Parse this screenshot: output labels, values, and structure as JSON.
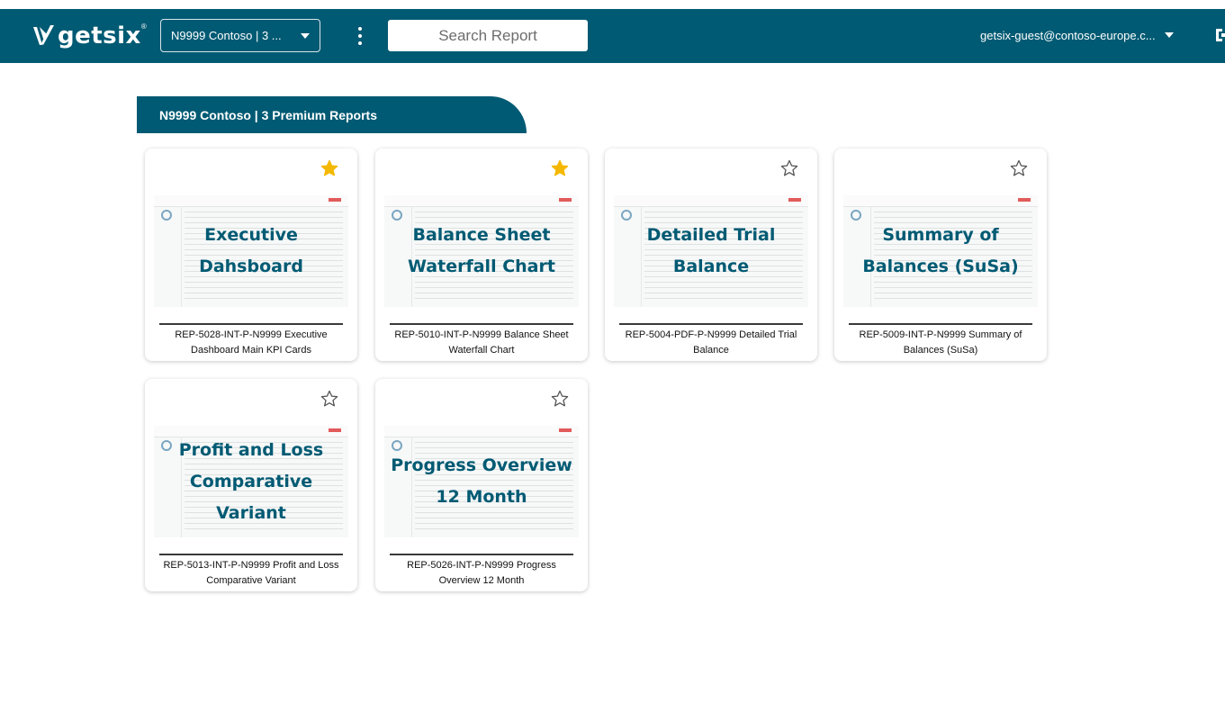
{
  "header": {
    "logo_text": "getsix",
    "logo_reg": "®",
    "client_selector": "N9999 Contoso | 3 ...",
    "search_placeholder": "Search Report",
    "user": "getsix-guest@contoso-europe.c..."
  },
  "section": {
    "title": "N9999 Contoso | 3 Premium Reports"
  },
  "reports": [
    {
      "thumb_title": "Executive\nDahsboard",
      "caption": "REP-5028-INT-P-N9999 Executive Dashboard Main KPI Cards",
      "favorite": true
    },
    {
      "thumb_title": "Balance Sheet\nWaterfall Chart",
      "caption": "REP-5010-INT-P-N9999 Balance Sheet Waterfall Chart",
      "favorite": true
    },
    {
      "thumb_title": "Detailed Trial\nBalance",
      "caption": "REP-5004-PDF-P-N9999 Detailed Trial Balance",
      "favorite": false
    },
    {
      "thumb_title": "Summary of\nBalances (SuSa)",
      "caption": "REP-5009-INT-P-N9999 Summary of Balances (SuSa)",
      "favorite": false
    },
    {
      "thumb_title": "Profit and Loss\nComparative\nVariant",
      "caption": "REP-5013-INT-P-N9999 Profit and Loss Comparative Variant",
      "favorite": false
    },
    {
      "thumb_title": "Progress Overview\n12 Month",
      "caption": "REP-5026-INT-P-N9999 Progress Overview 12 Month",
      "favorite": false
    }
  ],
  "colors": {
    "brand": "#005a73",
    "star_active": "#f5b800",
    "star_inactive": "#555555"
  },
  "icons": {
    "favorite": "star-filled-icon",
    "not_favorite": "star-outline-icon",
    "menu": "kebab-menu-icon",
    "logout": "logout-icon",
    "dropdown": "chevron-down-icon"
  }
}
